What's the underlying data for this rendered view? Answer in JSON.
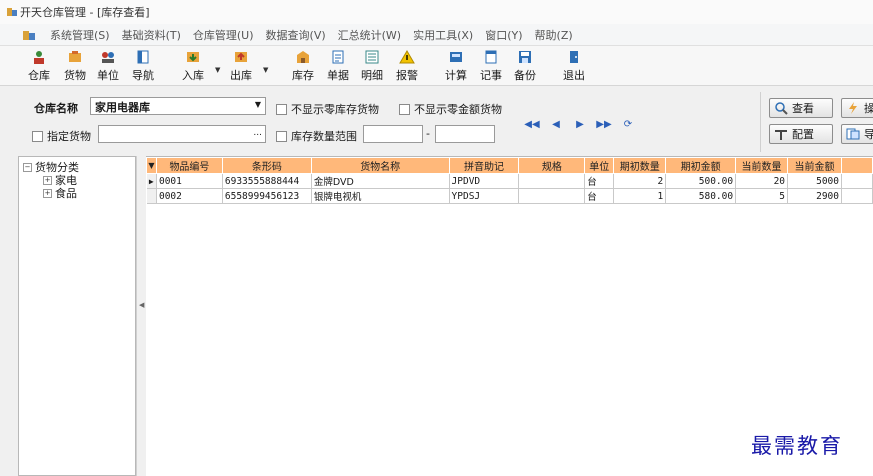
{
  "window": {
    "title": "开天仓库管理 - [库存查看]"
  },
  "menu": [
    "系统管理(S)",
    "基础资料(T)",
    "仓库管理(U)",
    "数据查询(V)",
    "汇总统计(W)",
    "实用工具(X)",
    "窗口(Y)",
    "帮助(Z)"
  ],
  "toolbar": {
    "warehouse": "仓库",
    "goods": "货物",
    "unit": "单位",
    "nav": "导航",
    "inbound": "入库",
    "outbound": "出库",
    "stock": "库存",
    "documents": "单据",
    "detail": "明细",
    "alarm": "报警",
    "calc": "计算",
    "notes": "记事",
    "backup": "备份",
    "exit": "退出"
  },
  "filters": {
    "warehouse_label": "仓库名称",
    "warehouse_value": "家用电器库",
    "hide_zero_stock": "不显示零库存货物",
    "hide_zero_amount": "不显示零金额货物",
    "specified_goods": "指定货物",
    "stock_range": "库存数量范围",
    "range_dash": "-",
    "ellipsis": "..."
  },
  "side_buttons": {
    "view": "查看",
    "config": "配置",
    "op1": "操",
    "op2": "导"
  },
  "tree": {
    "root": "货物分类",
    "children": [
      "家电",
      "食品"
    ],
    "root_toggle": "−",
    "child_toggle": "+"
  },
  "grid": {
    "columns": [
      "物品编号",
      "条形码",
      "货物名称",
      "拼音助记",
      "规格",
      "单位",
      "期初数量",
      "期初金额",
      "当前数量",
      "当前金额",
      ""
    ],
    "rows": [
      {
        "marker": "▶",
        "cells": [
          "0001",
          "6933555888444",
          "金牌DVD",
          "JPDVD",
          "",
          "台",
          "2",
          "500.00",
          "20",
          "5000",
          ""
        ]
      },
      {
        "marker": "",
        "cells": [
          "0002",
          "6558999456123",
          "银牌电视机",
          "YPDSJ",
          "",
          "台",
          "1",
          "580.00",
          "5",
          "2900",
          ""
        ]
      }
    ]
  },
  "watermark": "最需教育",
  "colors": {
    "header": "#ffb87a",
    "nav": "#2b5fb8",
    "watermark": "#1a1aa8"
  }
}
